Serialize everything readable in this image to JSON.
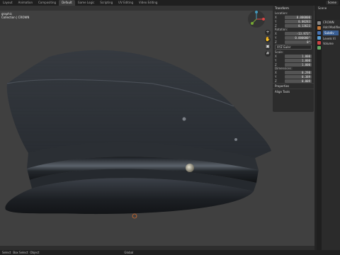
{
  "topbar": {
    "tabs": [
      "Layout",
      "Animation",
      "Compositing",
      "Default",
      "Game Logic",
      "Scripting",
      "UV Editing",
      "Video Editing"
    ],
    "active_tab": "Default",
    "scene": "Scene"
  },
  "viewport": {
    "view_name": "graphic",
    "collection": "Collection | CROWN"
  },
  "npanel": {
    "header": "Transform",
    "location_label": "Location:",
    "location": [
      "0.000000",
      "0.00283",
      "0.13623"
    ],
    "rotation_label": "Rotation:",
    "rotation": [
      "-13.973°",
      "0.000000°",
      "0°"
    ],
    "rotation_mode": "XYZ Euler",
    "scale_label": "Scale:",
    "scale": [
      "1.000",
      "1.000",
      "1.000"
    ],
    "dimensions_label": "Dimensions:",
    "dimensions": [
      "0.298",
      "0.389",
      "0.009"
    ],
    "axes": [
      "X",
      "Y",
      "Z"
    ],
    "properties": "Properties",
    "align_tools": "Align Tools"
  },
  "outliner": {
    "label": "Scene"
  },
  "props": {
    "object": "CROWN",
    "add_modifier": "Add Modifier",
    "items": [
      "Subdiv",
      "Levels Vi",
      "Volume"
    ]
  },
  "status": {
    "items": [
      "Select",
      "Box Select",
      "Object"
    ],
    "mode": "Global"
  },
  "colors": {
    "accent": "#4772b3",
    "hat_dark": "#1e2124",
    "hat_mid": "#2d3136"
  }
}
